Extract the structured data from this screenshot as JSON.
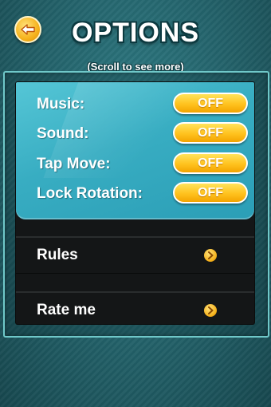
{
  "header": {
    "title": "OPTIONS",
    "subtitle": "(Scroll to see more)",
    "back_icon": "back-arrow-icon"
  },
  "toggles": [
    {
      "label": "Music:",
      "value": "OFF"
    },
    {
      "label": "Sound:",
      "value": "OFF"
    },
    {
      "label": "Tap Move:",
      "value": "OFF"
    },
    {
      "label": "Lock Rotation:",
      "value": "OFF"
    }
  ],
  "menu": [
    {
      "label": "Rules",
      "icon": "chevron-right-icon"
    },
    {
      "label": "Rate me",
      "icon": "chevron-right-icon"
    }
  ],
  "colors": {
    "background": "#226068",
    "panel_accent": "#38adc2",
    "button": "#ffc21e",
    "list_bg": "#141617"
  }
}
